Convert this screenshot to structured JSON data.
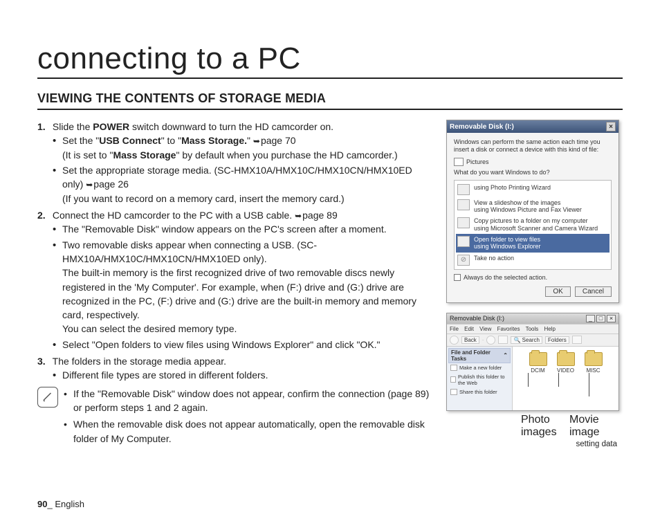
{
  "page_title": "connecting to a PC",
  "section_title": "VIEWING THE CONTENTS OF STORAGE MEDIA",
  "steps": [
    {
      "num": "1.",
      "text_pre": "Slide the ",
      "bold1": "POWER",
      "text_post": " switch downward to turn the HD camcorder on.",
      "bullets": [
        {
          "pre": "Set the \"",
          "b1": "USB Connect",
          "mid": "\" to \"",
          "b2": "Mass Storage.",
          "post": "\" ",
          "pageref": "page 70",
          "line2_pre": "(It is set to \"",
          "line2_b": "Mass Storage",
          "line2_post": "\" by default when you purchase the HD camcorder.)"
        },
        {
          "text": "Set the appropriate storage media. (SC-HMX10A/HMX10C/HMX10CN/HMX10ED only) ",
          "pageref": "page 26",
          "line2": "(If you want to record on a memory card, insert the memory card.)"
        }
      ]
    },
    {
      "num": "2.",
      "text": "Connect the HD camcorder to the PC with a USB cable. ",
      "pageref": "page 89",
      "bullets": [
        {
          "text": "The \"Removable Disk\" window appears on the PC's screen after a moment."
        },
        {
          "text": "Two removable disks appear when connecting a USB. (SC-HMX10A/HMX10C/HMX10CN/HMX10ED only).",
          "line2": "The built-in memory is the first recognized drive of two removable discs newly registered in the 'My Computer'. For example, when (F:) drive and (G:) drive are recognized in the PC, (F:) drive and (G:) drive are the built-in memory and memory card, respectively.",
          "line3": "You can select the desired memory type."
        },
        {
          "text": "Select \"Open folders to view files using Windows Explorer\" and click \"OK.\""
        }
      ]
    },
    {
      "num": "3.",
      "text": "The folders in the storage media appear.",
      "bullets": [
        {
          "text": "Different file types are stored in different folders."
        }
      ]
    }
  ],
  "note": {
    "bullets": [
      "If the \"Removable Disk\" window does not appear, confirm the connection (page 89) or perform steps 1 and 2 again.",
      "When the removable disk does not appear automatically, open the removable disk folder of My Computer."
    ]
  },
  "dialog1": {
    "title": "Removable Disk (I:)",
    "intro": "Windows can perform the same action each time you insert a disk or connect a device with this kind of file:",
    "pic_label": "Pictures",
    "prompt": "What do you want Windows to do?",
    "options": [
      {
        "text": "using Photo Printing Wizard"
      },
      {
        "text": "View a slideshow of the images\nusing Windows Picture and Fax Viewer"
      },
      {
        "text": "Copy pictures to a folder on my computer\nusing Microsoft Scanner and Camera Wizard"
      },
      {
        "text": "Open folder to view files\nusing Windows Explorer",
        "selected": true
      },
      {
        "text": "Take no action"
      }
    ],
    "checkbox": "Always do the selected action.",
    "ok": "OK",
    "cancel": "Cancel"
  },
  "explorer": {
    "title": "Removable Disk (I:)",
    "menus": [
      "File",
      "Edit",
      "View",
      "Favorites",
      "Tools",
      "Help"
    ],
    "toolbar": {
      "back": "Back",
      "search": "Search",
      "folders": "Folders"
    },
    "side_header": "File and Folder Tasks",
    "side_items": [
      "Make a new folder",
      "Publish this folder to the Web",
      "Share this folder"
    ],
    "folders": [
      "DCIM",
      "VIDEO",
      "MISC"
    ]
  },
  "callouts": {
    "photo": "Photo images",
    "movie": "Movie image",
    "setting": "setting data"
  },
  "footer": {
    "page": "90",
    "sep": "_ ",
    "lang": "English"
  }
}
